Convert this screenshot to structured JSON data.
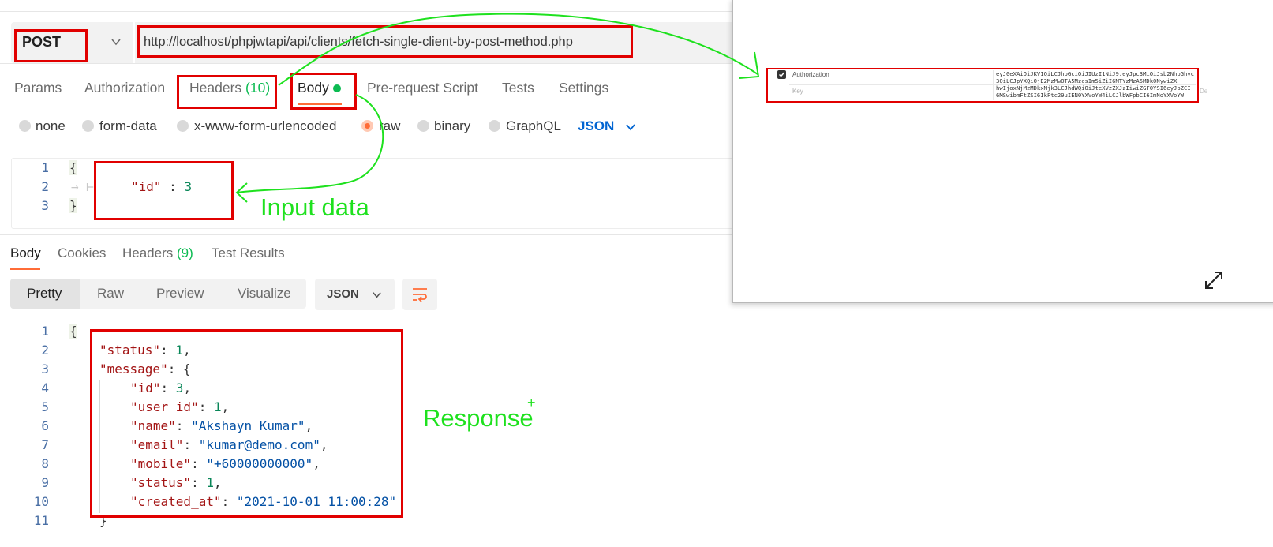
{
  "request": {
    "method": "POST",
    "url": "http://localhost/phpjwtapi/api/clients/fetch-single-client-by-post-method.php",
    "tabs": {
      "params": "Params",
      "authorization": "Authorization",
      "headers": "Headers",
      "headers_count": "(10)",
      "body": "Body",
      "prerequest": "Pre-request Script",
      "tests": "Tests",
      "settings": "Settings"
    },
    "body_modes": {
      "none": "none",
      "form_data": "form-data",
      "urlencoded": "x-www-form-urlencoded",
      "raw": "raw",
      "binary": "binary",
      "graphql": "GraphQL",
      "language": "JSON"
    },
    "body_lines": {
      "l1": "{",
      "l2_key": "\"id\"",
      "l2_sep": " : ",
      "l2_val": "3",
      "l3": "}"
    },
    "line_numbers": [
      "1",
      "2",
      "3"
    ]
  },
  "response": {
    "tabs": {
      "body": "Body",
      "cookies": "Cookies",
      "headers": "Headers",
      "headers_count": "(9)",
      "test_results": "Test Results"
    },
    "views": {
      "pretty": "Pretty",
      "raw": "Raw",
      "preview": "Preview",
      "visualize": "Visualize",
      "format": "JSON"
    },
    "line_numbers": [
      "1",
      "2",
      "3",
      "4",
      "5",
      "6",
      "7",
      "8",
      "9",
      "10",
      "11"
    ],
    "lines": {
      "open": "{",
      "status_key": "\"status\"",
      "status_val": "1",
      "message_key": "\"message\"",
      "message_open": "{",
      "id_key": "\"id\"",
      "id_val": "3",
      "user_id_key": "\"user_id\"",
      "user_id_val": "1",
      "name_key": "\"name\"",
      "name_val": "\"Akshayn Kumar\"",
      "email_key": "\"email\"",
      "email_val": "\"kumar@demo.com\"",
      "mobile_key": "\"mobile\"",
      "mobile_val": "\"+60000000000\"",
      "status2_key": "\"status\"",
      "status2_val": "1",
      "created_key": "\"created_at\"",
      "created_val": "\"2021-10-01 11:00:28\"",
      "close": "}"
    }
  },
  "annotations": {
    "input_data": "Input data",
    "response": "Response",
    "plus": "+"
  },
  "overlay": {
    "header_key": "Authorization",
    "placeholder_key": "Key",
    "token_lines": [
      "eyJ0eXAiOiJKV1QiLCJhbGciOiJIUzI1NiJ9.eyJpc3MiOiJsb2NhbGhvc",
      "3QiLCJpYXQiOjE2MzMwOTA5MzcsIm5iZiI6MTYzMzA5MDk0NywiZX",
      "hwIjoxNjMzMDkxMjk3LCJhdWQiOiJteXVzZXJzIiwiZGF0YSI6eyJpZCI",
      "6MSwibmFtZSI6IkFtc29uIEN0YXVoYW4iLCJlbWFpbCI6ImNoYXVoYW"
    ],
    "trailing": "De"
  },
  "colors": {
    "accent": "#ff6c37",
    "count_green": "#0cbb52",
    "json_blue": "#0265d2",
    "annotation_red": "#e10000",
    "annotation_green": "#1ee11e"
  }
}
